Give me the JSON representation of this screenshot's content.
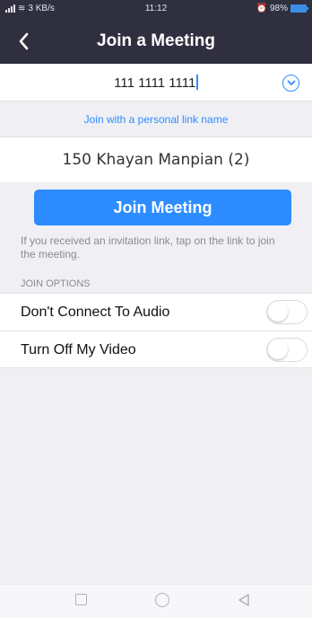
{
  "status_bar": {
    "network": "3 KB/s",
    "time": "11:12",
    "battery": "98%"
  },
  "header": {
    "title": "Join a Meeting",
    "back_icon": "chevron-left-icon"
  },
  "meeting_id": {
    "value": "111 1111 1111",
    "dropdown_icon": "chevron-down-circle-icon"
  },
  "personal_link_label": "Join with a personal link name",
  "display_name": {
    "value": "150 Khayan Manpian (2)"
  },
  "join_button_label": "Join Meeting",
  "hint": "If you received an invitation link, tap on the link to join the meeting.",
  "join_options": {
    "header": "JOIN OPTIONS",
    "items": [
      {
        "label": "Don't Connect To Audio",
        "enabled": false
      },
      {
        "label": "Turn Off My Video",
        "enabled": false
      }
    ]
  },
  "colors": {
    "header_bg": "#2f2f3f",
    "accent": "#2d8cff",
    "page_bg": "#f0f0f4"
  }
}
